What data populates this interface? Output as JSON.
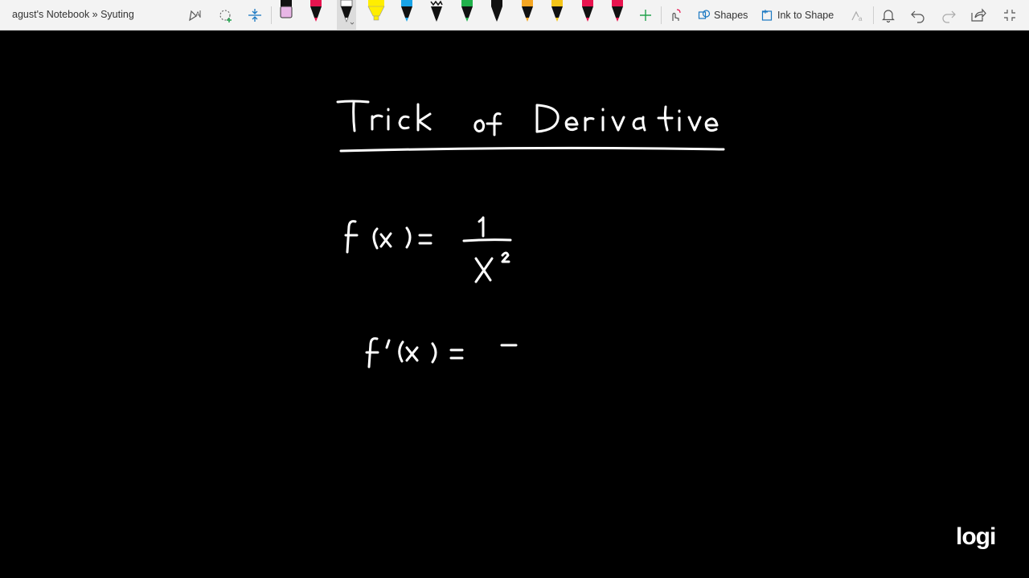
{
  "app": {
    "breadcrumb": "agust's Notebook » Syuting"
  },
  "toolbar": {
    "shapes_label": "Shapes",
    "ink_to_shape_label": "Ink to Shape",
    "pen_colors": [
      "#e8b6e6",
      "#e8144f",
      "#ffffff",
      "#ffee00",
      "#1aa4e8",
      "#111111",
      "#22b14c",
      "#111111",
      "#f5a623",
      "#f5c518",
      "#e8144f",
      "#e8144f"
    ]
  },
  "canvas": {
    "watermark": "logi"
  }
}
